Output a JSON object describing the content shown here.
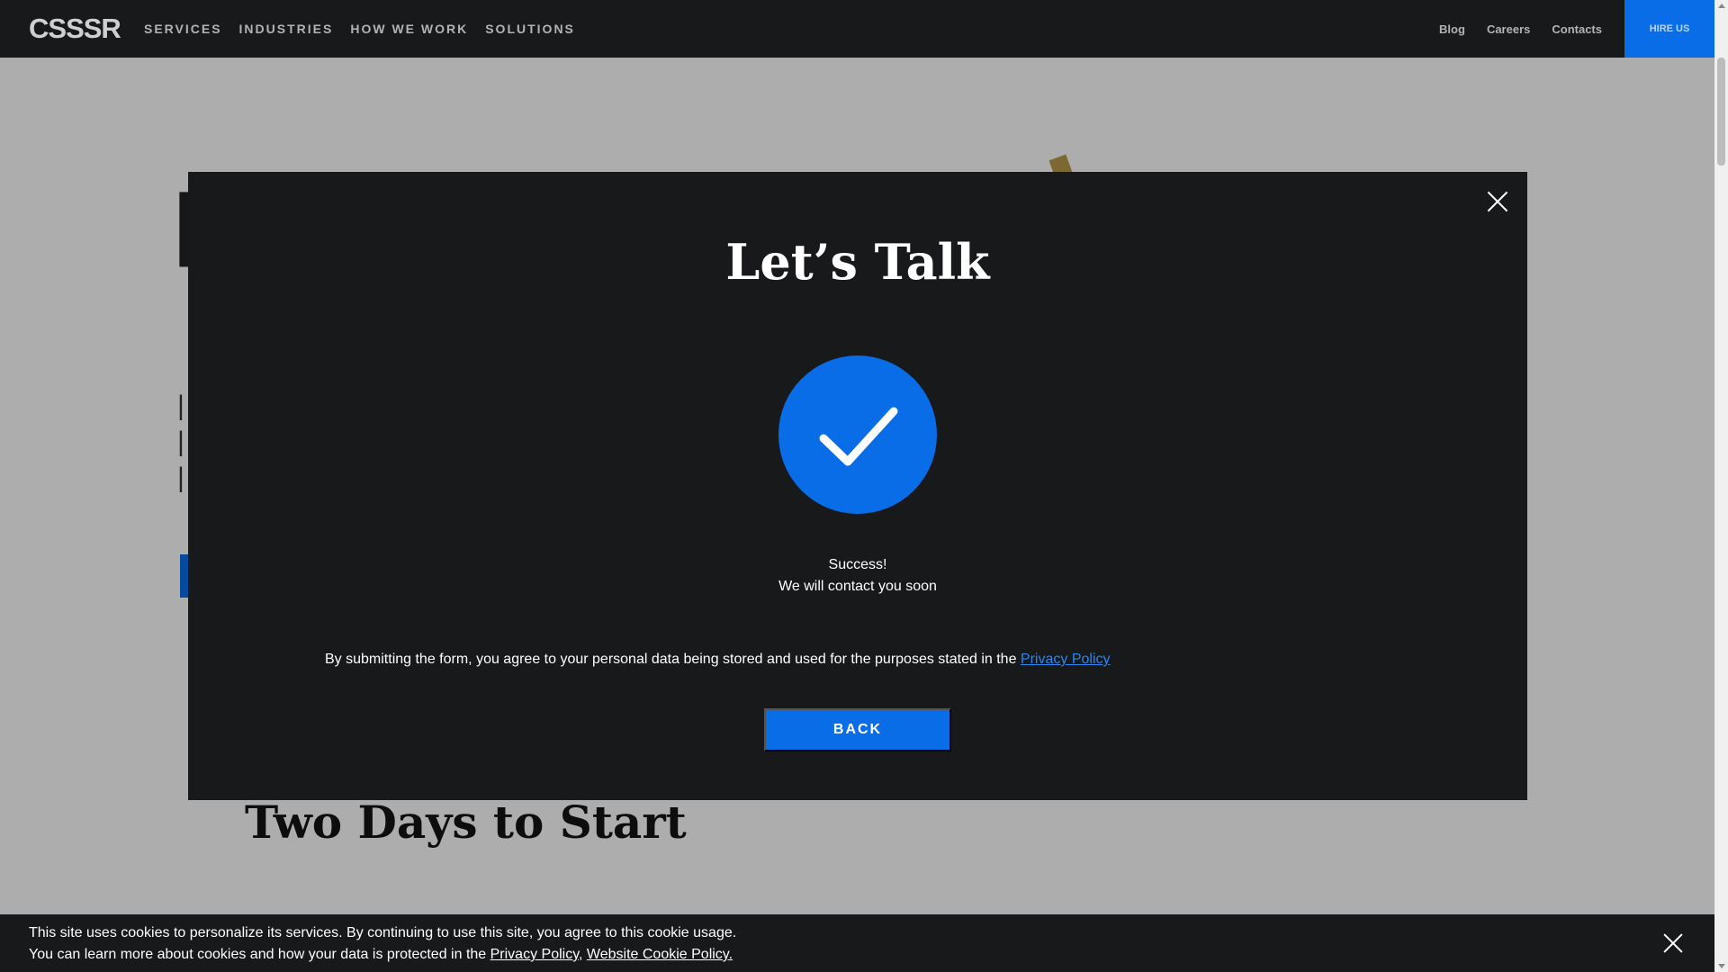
{
  "nav": {
    "logo": "CSSSR",
    "left_items": [
      {
        "label": "SERVICES"
      },
      {
        "label": "INDUSTRIES"
      },
      {
        "label": "HOW WE WORK"
      },
      {
        "label": "SOLUTIONS"
      }
    ],
    "right_items": [
      {
        "label": "Blog"
      },
      {
        "label": "Careers"
      },
      {
        "label": "Contacts"
      }
    ],
    "hire_label": "HIRE US"
  },
  "page": {
    "section_title": "Two Days to Start"
  },
  "modal": {
    "title": "Let’s Talk",
    "success_line1": "Success!",
    "success_line2": "We will contact you soon",
    "consent_text": "By submitting the form, you agree to your personal data being stored and used for the purposes stated in the ",
    "privacy_link": "Privacy Policy",
    "back_label": "BACK"
  },
  "cookie": {
    "line1": "This site uses cookies to personalize its services. By continuing to use this site, you agree to this cookie usage.",
    "line2_prefix": "You can learn more about cookies and how your data is protected in the ",
    "privacy_link": "Privacy Policy",
    "separator": ",",
    "cookie_policy_link": "Website Cookie Policy."
  },
  "colors": {
    "accent": "#0a6de8",
    "dark_bg": "#18191b",
    "link": "#2b86f0"
  },
  "icons": {
    "modal_close": "close-icon",
    "success": "checkmark-icon",
    "cookie_close": "close-icon"
  }
}
